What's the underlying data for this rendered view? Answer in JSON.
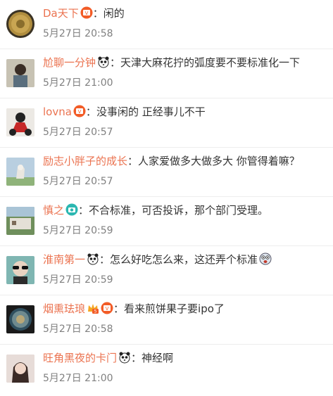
{
  "comments": [
    {
      "user": "Da天下",
      "badges": [
        "red-v-badge-icon"
      ],
      "text": "闲的",
      "time": "5月27日 20:58",
      "avatar": "coin-avatar"
    },
    {
      "user": "尬聊一分钟",
      "badges": [
        "panda-emoji-icon"
      ],
      "text": "天津大麻花拧的弧度要不要标准化一下",
      "time": "5月27日 21:00",
      "avatar": "person-avatar"
    },
    {
      "user": "lovna",
      "badges": [
        "red-v-badge-icon"
      ],
      "text": "没事闲的 正经事儿不干",
      "time": "5月27日 20:57",
      "avatar": "motorcycle-avatar"
    },
    {
      "user": "励志小胖子的成长",
      "badges": [],
      "text": "人家爱做多大做多大 你管得着嘛？",
      "time": "5月27日 20:57",
      "avatar": "dog-avatar"
    },
    {
      "user": "慎之",
      "badges": [
        "camera-badge-icon"
      ],
      "text": "不合标准，可否投诉，那个部门受理。",
      "time": "5月27日 20:59",
      "avatar": "landscape-avatar"
    },
    {
      "user": "淮南第一",
      "badges": [
        "panda-emoji-icon"
      ],
      "text": "怎么好吃怎么来，这还弄个标准",
      "time": "5月27日 20:59",
      "avatar": "sunglasses-avatar",
      "trailing_emoji": "shocked-face-emoji-icon"
    },
    {
      "user": "烟熏珐琅",
      "badges": [
        "crown-badge-icon",
        "red-v-badge-icon"
      ],
      "text": "看来煎饼果子要ipo了",
      "time": "5月27日 20:58",
      "avatar": "plate-avatar"
    },
    {
      "user": "旺角黑夜的卡门",
      "badges": [
        "panda-emoji-icon"
      ],
      "text": "神经啊",
      "time": "5月27日 21:00",
      "avatar": "girl-avatar"
    }
  ],
  "separator": "：",
  "colors": {
    "username": "#eb7350",
    "text": "#333333",
    "time": "#808080"
  }
}
